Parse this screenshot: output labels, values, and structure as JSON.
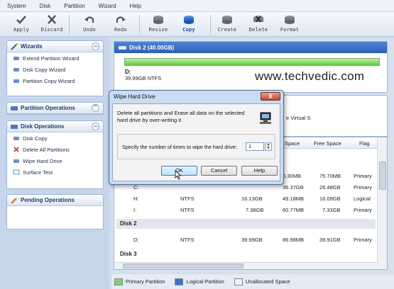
{
  "menu": [
    "System",
    "Disk",
    "Partition",
    "Wizard",
    "Help"
  ],
  "toolbar": {
    "apply": "Apply",
    "discard": "Discard",
    "undo": "Undo",
    "redo": "Redo",
    "resize": "Resize",
    "copy": "Copy",
    "create": "Create",
    "delete": "Delete",
    "format": "Format"
  },
  "sidebar": {
    "wizards": {
      "title": "Wizards",
      "items": [
        "Extend Partition Wizard",
        "Disk Copy Wizard",
        "Partition Copy Wizard"
      ]
    },
    "partition_ops": {
      "title": "Partition Operations"
    },
    "disk_ops": {
      "title": "Disk Operations",
      "items": [
        "Disk Copy",
        "Delete All Partitions",
        "Wipe Hard Drive",
        "Surface Test"
      ]
    },
    "pending": {
      "title": "Pending Operations"
    }
  },
  "diskmap": {
    "title": "Disk 2 (40.00GB)",
    "partition_name": "D:",
    "partition_info": "39.99GB NTFS",
    "watermark": "www.techvedic.com",
    "virtual_fragment": "e Virtual S"
  },
  "table": {
    "headers": [
      "Space",
      "Free Space",
      "Flag"
    ],
    "rows_top": [
      {
        "used": "0.30MB",
        "free": "75.70MB",
        "flag": "Primary"
      },
      {
        "name": "C:",
        "used": "36.37GB",
        "free": "28.48GB",
        "flag": "Primary"
      },
      {
        "name": "H:",
        "fs": "NTFS",
        "cap": "16.13GB",
        "used": "49.18MB",
        "free": "16.09GB",
        "flag": "Logical"
      },
      {
        "name": "I:",
        "fs": "NTFS",
        "cap": "7.38GB",
        "used": "60.77MB",
        "free": "7.33GB",
        "flag": "Primary"
      }
    ],
    "group2": "Disk 2",
    "row_d": {
      "name": "D:",
      "fs": "NTFS",
      "cap": "39.99GB",
      "used": "86.98MB",
      "free": "39.91GB",
      "flag": "Primary"
    },
    "group3": "Disk 3"
  },
  "legend": {
    "primary": "Primary Partition",
    "logical": "Logical Partition",
    "unallocated": "Unallocated Space"
  },
  "dialog": {
    "title": "Wipe Hard Drive",
    "close": "X",
    "message": "Delete all partitions and Erase all data on the selected hard drive by over-writing it.",
    "label": "Specify the number of times to wipe the hard drive:",
    "value": "1",
    "ok": "OK",
    "cancel": "Cancel",
    "help": "Help"
  },
  "colors": {
    "primary": "#7ed36b",
    "logical": "#3f6fd0",
    "unallocated": "#f2f2f2"
  }
}
